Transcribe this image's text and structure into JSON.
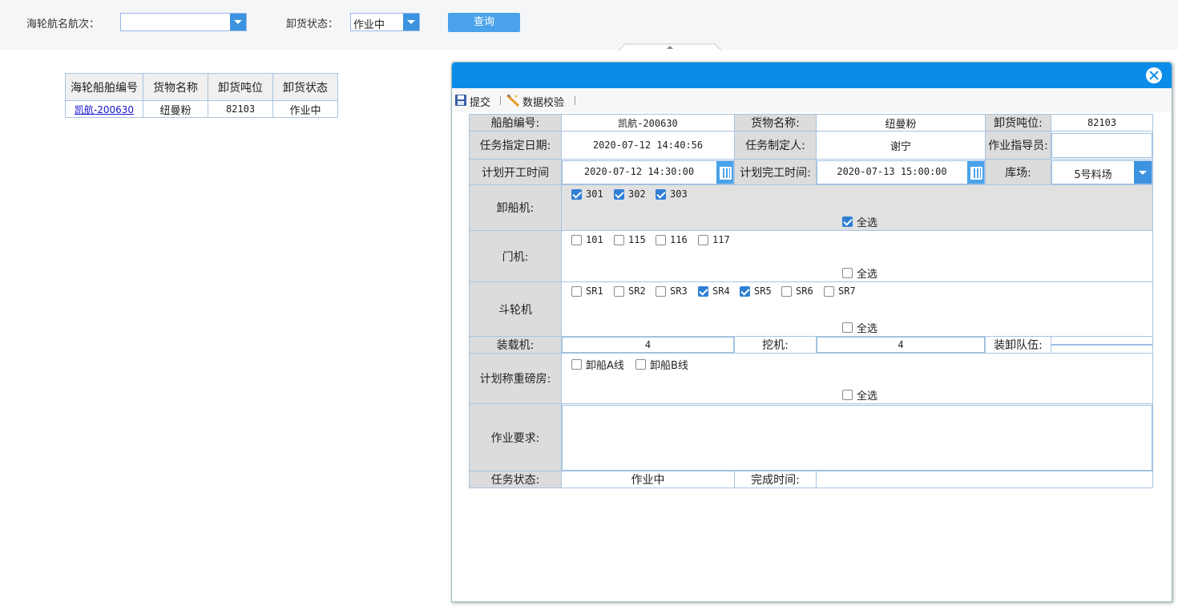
{
  "query": {
    "voyage_label": "海轮航名航次：",
    "voyage_value": "",
    "status_label": "卸货状态：",
    "status_value": "作业中",
    "search_button": "查询"
  },
  "grid": {
    "headers": [
      "海轮船舶编号",
      "货物名称",
      "卸货吨位",
      "卸货状态"
    ],
    "rows": [
      {
        "ship_no": "凯航-200630",
        "cargo": "纽曼粉",
        "tonnage": "82103",
        "status": "作业中"
      }
    ]
  },
  "dialog": {
    "toolbar": {
      "submit": "提交",
      "validate": "数据校验"
    },
    "form": {
      "ship_no_label": "船舶编号:",
      "ship_no": "凯航-200630",
      "cargo_label": "货物名称:",
      "cargo": "纽曼粉",
      "tonnage_label": "卸货吨位:",
      "tonnage": "82103",
      "assign_date_label": "任务指定日期:",
      "assign_date": "2020-07-12 14:40:56",
      "creator_label": "任务制定人:",
      "creator": "谢宁",
      "guide_label": "作业指导员:",
      "guide": "",
      "plan_start_label": "计划开工时间",
      "plan_start": "2020-07-12 14:30:00",
      "plan_end_label": "计划完工时间:",
      "plan_end": "2020-07-13 15:00:00",
      "yard_label": "库场:",
      "yard": "5号料场",
      "unloader_label": "卸船机:",
      "unloaders": [
        {
          "label": "301",
          "checked": true
        },
        {
          "label": "302",
          "checked": true
        },
        {
          "label": "303",
          "checked": true
        }
      ],
      "unloader_all": "全选",
      "portal_label": "门机:",
      "portals": [
        {
          "label": "101",
          "checked": false
        },
        {
          "label": "115",
          "checked": false
        },
        {
          "label": "116",
          "checked": false
        },
        {
          "label": "117",
          "checked": false
        }
      ],
      "portal_all": "全选",
      "bucket_label": "斗轮机",
      "buckets": [
        {
          "label": "SR1",
          "checked": false
        },
        {
          "label": "SR2",
          "checked": false
        },
        {
          "label": "SR3",
          "checked": false
        },
        {
          "label": "SR4",
          "checked": true
        },
        {
          "label": "SR5",
          "checked": true
        },
        {
          "label": "SR6",
          "checked": false
        },
        {
          "label": "SR7",
          "checked": false
        }
      ],
      "bucket_all": "全选",
      "loader_label": "装载机:",
      "loader": "4",
      "excavator_label": "挖机:",
      "excavator": "4",
      "team_label": "装卸队伍:",
      "team": "",
      "weigh_label": "计划称重磅房:",
      "weighs": [
        {
          "label": "卸船A线",
          "checked": false
        },
        {
          "label": "卸船B线",
          "checked": false
        }
      ],
      "weigh_all": "全选",
      "req_label": "作业要求:",
      "req": "",
      "task_status_label": "任务状态:",
      "task_status": "作业中",
      "done_time_label": "完成时间:",
      "done_time": ""
    }
  },
  "colors": {
    "header_blue": "#0c8ce9",
    "button_blue": "#4aa3ea",
    "check_blue": "#2f7fd4"
  }
}
